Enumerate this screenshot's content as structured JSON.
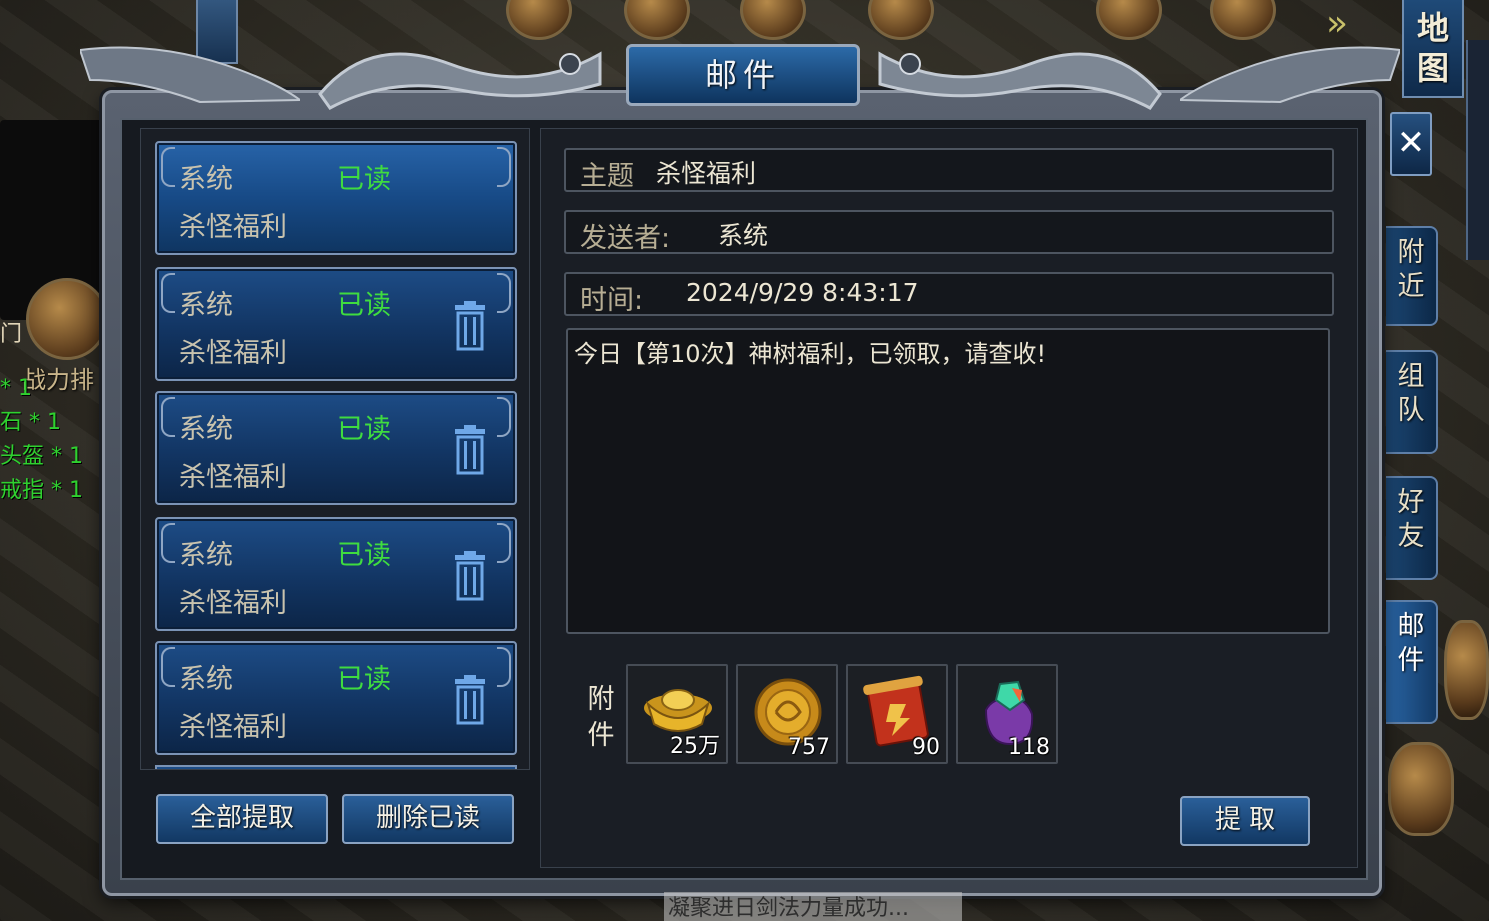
{
  "window": {
    "title": "邮件",
    "close_icon": "close-icon"
  },
  "side_tabs": {
    "map": "地\n图",
    "nearby": "附\n近",
    "team": "组\n队",
    "friends": "好\n友",
    "mail": "邮\n件"
  },
  "background": {
    "left_lines": [
      "* 1",
      "石 * 1",
      "头盔 * 1",
      "戒指 * 1"
    ],
    "left_tag": "战力排",
    "left_door": "门",
    "chat_text": "凝聚进日剑法力量成功..."
  },
  "mail_list": {
    "items": [
      {
        "sender": "系统",
        "state": "已读",
        "subject": "杀怪福利",
        "selected": true,
        "show_trash": false
      },
      {
        "sender": "系统",
        "state": "已读",
        "subject": "杀怪福利",
        "selected": false,
        "show_trash": true
      },
      {
        "sender": "系统",
        "state": "已读",
        "subject": "杀怪福利",
        "selected": false,
        "show_trash": true
      },
      {
        "sender": "系统",
        "state": "已读",
        "subject": "杀怪福利",
        "selected": false,
        "show_trash": true
      },
      {
        "sender": "系统",
        "state": "已读",
        "subject": "杀怪福利",
        "selected": false,
        "show_trash": true
      }
    ],
    "claim_all_label": "全部提取",
    "delete_read_label": "删除已读"
  },
  "detail": {
    "subject_label": "主题",
    "subject_value": "杀怪福利",
    "sender_label": "发送者:",
    "sender_value": "系统",
    "time_label": "时间:",
    "time_value": "2024/9/29 8:43:17",
    "body": "今日【第10次】神树福利，已领取，请查收!",
    "attachments_label": "附\n件",
    "attachments": [
      {
        "icon": "gold-ingot-icon",
        "count": "25万"
      },
      {
        "icon": "gold-coin-icon",
        "count": "757"
      },
      {
        "icon": "red-scroll-icon",
        "count": "90"
      },
      {
        "icon": "gem-pouch-icon",
        "count": "118"
      }
    ],
    "claim_label": "提 取"
  },
  "colors": {
    "read_status": "#3fdc3f",
    "panel_blue": "#1d4c86",
    "frame_steel": "#8e96a3"
  }
}
